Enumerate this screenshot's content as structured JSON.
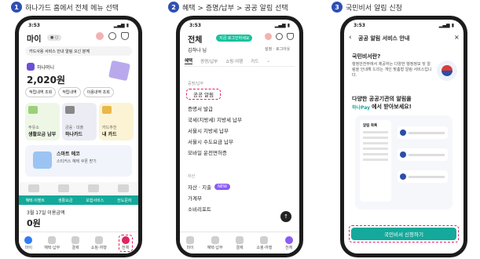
{
  "steps": [
    {
      "num": "1",
      "label": "하나가드 홈에서 전체 메뉴 선택"
    },
    {
      "num": "2",
      "label": "혜택 > 증명/납부 > 공공 알림 선택"
    },
    {
      "num": "3",
      "label": "국민비서 알림 신청"
    }
  ],
  "phone1": {
    "time": "3:53",
    "title": "마이",
    "notice": "카드사용 서비스 안내 알림 오신 분께",
    "points_label": "하나머니",
    "points": "2,020원",
    "quick": [
      "적립내역 조회",
      "적립내역",
      "이용내역 조회"
    ],
    "tiles": [
      {
        "title": "생활요금 납부",
        "sub": "주유소"
      },
      {
        "title": "하나카드",
        "sub": "금융 · 대출"
      },
      {
        "title": "내 카드",
        "sub": "카드추천"
      }
    ],
    "promo_title": "스마트 에코",
    "promo_sub": "스티커스 혜택 쿠폰 받기",
    "strip": [
      "혜택·이벤트",
      "생활요금",
      "보험서비스",
      "전도문자"
    ],
    "date_line": "3월 17일 이용금액",
    "amount": "0원",
    "nav": [
      "마이",
      "혜택·납부",
      "결제",
      "쇼핑·여행",
      "전체"
    ]
  },
  "phone2": {
    "time": "3:53",
    "title": "전체",
    "pill": "지금 로그인하세요",
    "user": "김하나 님",
    "settings": "설정 · 로그아웃",
    "tabs": [
      "혜택",
      "증명/납부",
      "쇼핑·여행",
      "카드"
    ],
    "section": "증명/납부",
    "highlight": "공공 알림",
    "items": [
      "증명서 발급",
      "국세(지방세) 지방세 납부",
      "서울시 지방세 납부",
      "서울시 수도요금 납부",
      "모바일 운전면허증"
    ],
    "section2": "자산",
    "items2": [
      "자산 · 지출",
      "가계부",
      "소비리포트"
    ],
    "new_badge": "NEW",
    "nav": [
      "마이",
      "혜택·납부",
      "결제",
      "쇼핑·여행",
      "전체"
    ]
  },
  "phone3": {
    "time": "3:53",
    "title": "공공 알림 서비스 안내",
    "q": "국민비서란?",
    "desc": "행정안전부에서 제공하는 다양한 행정정보 및 알림을 안내해 드리는 개인 맞춤형 알림 서비스입니다.",
    "headline1": "다양한 공공기관의 알림을",
    "headline2": "에서 받아보세요!",
    "brand": "하나Pay",
    "list_header": "알림 목록",
    "cta": "국민비서 신청하기"
  }
}
